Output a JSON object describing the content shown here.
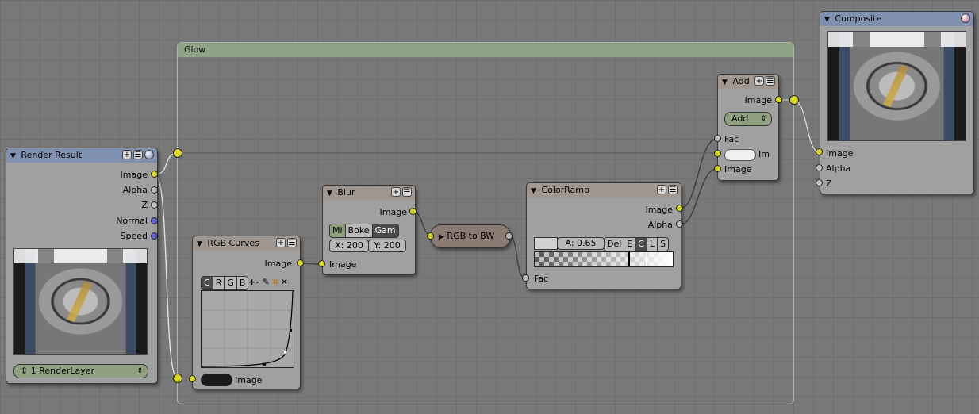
{
  "group": {
    "title": "Glow"
  },
  "render_result": {
    "title": "Render Result",
    "outputs": [
      "Image",
      "Alpha",
      "Z",
      "Normal",
      "Speed"
    ],
    "layer_select": "1 RenderLayer"
  },
  "rgb_curves": {
    "title": "RGB Curves",
    "output": "Image",
    "channels": [
      "C",
      "R",
      "G",
      "B"
    ],
    "tools": [
      "+",
      "-",
      "wrench-icon",
      "clip-icon",
      "x-icon"
    ],
    "input": "Image"
  },
  "blur": {
    "title": "Blur",
    "output": "Image",
    "options": [
      "Mi",
      "Boke",
      "Gam"
    ],
    "x_field": "X: 200",
    "y_field": "Y: 200",
    "input": "Image"
  },
  "rgb_to_bw": {
    "title": "RGB to BW"
  },
  "color_ramp": {
    "title": "ColorRamp",
    "outputs": [
      "Image",
      "Alpha"
    ],
    "alpha_field": "A: 0.65",
    "buttons": [
      "Del",
      "E",
      "C",
      "L",
      "S"
    ],
    "input": "Fac"
  },
  "add": {
    "title": "Add",
    "output": "Image",
    "mode": "Add",
    "inputs": [
      "Fac",
      "Im",
      "Image"
    ]
  },
  "composite": {
    "title": "Composite",
    "inputs": [
      "Image",
      "Alpha",
      "Z"
    ]
  },
  "colors": {
    "socket_image": "#d8d828",
    "socket_value": "#c0c0c0",
    "socket_vector": "#6464d8",
    "group_header": "#8ea286"
  }
}
